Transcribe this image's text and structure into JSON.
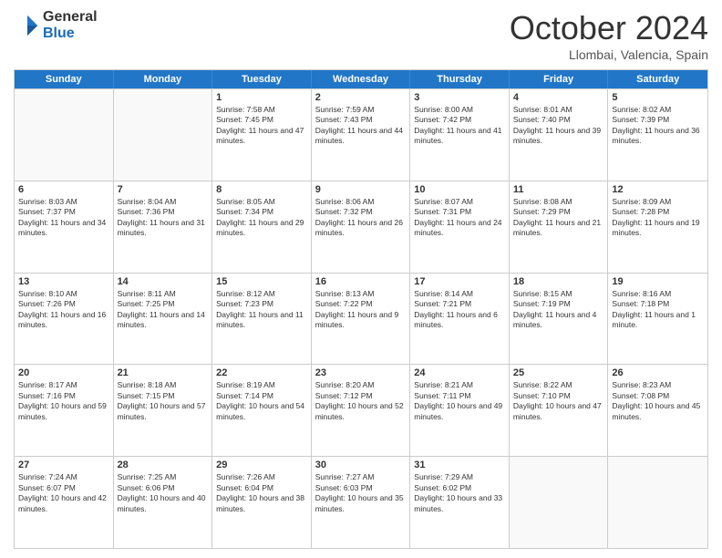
{
  "logo": {
    "general": "General",
    "blue": "Blue"
  },
  "title": "October 2024",
  "subtitle": "Llombai, Valencia, Spain",
  "header_days": [
    "Sunday",
    "Monday",
    "Tuesday",
    "Wednesday",
    "Thursday",
    "Friday",
    "Saturday"
  ],
  "rows": [
    [
      {
        "day": "",
        "sunrise": "",
        "sunset": "",
        "daylight": "",
        "empty": true
      },
      {
        "day": "",
        "sunrise": "",
        "sunset": "",
        "daylight": "",
        "empty": true
      },
      {
        "day": "1",
        "sunrise": "Sunrise: 7:58 AM",
        "sunset": "Sunset: 7:45 PM",
        "daylight": "Daylight: 11 hours and 47 minutes.",
        "empty": false
      },
      {
        "day": "2",
        "sunrise": "Sunrise: 7:59 AM",
        "sunset": "Sunset: 7:43 PM",
        "daylight": "Daylight: 11 hours and 44 minutes.",
        "empty": false
      },
      {
        "day": "3",
        "sunrise": "Sunrise: 8:00 AM",
        "sunset": "Sunset: 7:42 PM",
        "daylight": "Daylight: 11 hours and 41 minutes.",
        "empty": false
      },
      {
        "day": "4",
        "sunrise": "Sunrise: 8:01 AM",
        "sunset": "Sunset: 7:40 PM",
        "daylight": "Daylight: 11 hours and 39 minutes.",
        "empty": false
      },
      {
        "day": "5",
        "sunrise": "Sunrise: 8:02 AM",
        "sunset": "Sunset: 7:39 PM",
        "daylight": "Daylight: 11 hours and 36 minutes.",
        "empty": false
      }
    ],
    [
      {
        "day": "6",
        "sunrise": "Sunrise: 8:03 AM",
        "sunset": "Sunset: 7:37 PM",
        "daylight": "Daylight: 11 hours and 34 minutes.",
        "empty": false
      },
      {
        "day": "7",
        "sunrise": "Sunrise: 8:04 AM",
        "sunset": "Sunset: 7:36 PM",
        "daylight": "Daylight: 11 hours and 31 minutes.",
        "empty": false
      },
      {
        "day": "8",
        "sunrise": "Sunrise: 8:05 AM",
        "sunset": "Sunset: 7:34 PM",
        "daylight": "Daylight: 11 hours and 29 minutes.",
        "empty": false
      },
      {
        "day": "9",
        "sunrise": "Sunrise: 8:06 AM",
        "sunset": "Sunset: 7:32 PM",
        "daylight": "Daylight: 11 hours and 26 minutes.",
        "empty": false
      },
      {
        "day": "10",
        "sunrise": "Sunrise: 8:07 AM",
        "sunset": "Sunset: 7:31 PM",
        "daylight": "Daylight: 11 hours and 24 minutes.",
        "empty": false
      },
      {
        "day": "11",
        "sunrise": "Sunrise: 8:08 AM",
        "sunset": "Sunset: 7:29 PM",
        "daylight": "Daylight: 11 hours and 21 minutes.",
        "empty": false
      },
      {
        "day": "12",
        "sunrise": "Sunrise: 8:09 AM",
        "sunset": "Sunset: 7:28 PM",
        "daylight": "Daylight: 11 hours and 19 minutes.",
        "empty": false
      }
    ],
    [
      {
        "day": "13",
        "sunrise": "Sunrise: 8:10 AM",
        "sunset": "Sunset: 7:26 PM",
        "daylight": "Daylight: 11 hours and 16 minutes.",
        "empty": false
      },
      {
        "day": "14",
        "sunrise": "Sunrise: 8:11 AM",
        "sunset": "Sunset: 7:25 PM",
        "daylight": "Daylight: 11 hours and 14 minutes.",
        "empty": false
      },
      {
        "day": "15",
        "sunrise": "Sunrise: 8:12 AM",
        "sunset": "Sunset: 7:23 PM",
        "daylight": "Daylight: 11 hours and 11 minutes.",
        "empty": false
      },
      {
        "day": "16",
        "sunrise": "Sunrise: 8:13 AM",
        "sunset": "Sunset: 7:22 PM",
        "daylight": "Daylight: 11 hours and 9 minutes.",
        "empty": false
      },
      {
        "day": "17",
        "sunrise": "Sunrise: 8:14 AM",
        "sunset": "Sunset: 7:21 PM",
        "daylight": "Daylight: 11 hours and 6 minutes.",
        "empty": false
      },
      {
        "day": "18",
        "sunrise": "Sunrise: 8:15 AM",
        "sunset": "Sunset: 7:19 PM",
        "daylight": "Daylight: 11 hours and 4 minutes.",
        "empty": false
      },
      {
        "day": "19",
        "sunrise": "Sunrise: 8:16 AM",
        "sunset": "Sunset: 7:18 PM",
        "daylight": "Daylight: 11 hours and 1 minute.",
        "empty": false
      }
    ],
    [
      {
        "day": "20",
        "sunrise": "Sunrise: 8:17 AM",
        "sunset": "Sunset: 7:16 PM",
        "daylight": "Daylight: 10 hours and 59 minutes.",
        "empty": false
      },
      {
        "day": "21",
        "sunrise": "Sunrise: 8:18 AM",
        "sunset": "Sunset: 7:15 PM",
        "daylight": "Daylight: 10 hours and 57 minutes.",
        "empty": false
      },
      {
        "day": "22",
        "sunrise": "Sunrise: 8:19 AM",
        "sunset": "Sunset: 7:14 PM",
        "daylight": "Daylight: 10 hours and 54 minutes.",
        "empty": false
      },
      {
        "day": "23",
        "sunrise": "Sunrise: 8:20 AM",
        "sunset": "Sunset: 7:12 PM",
        "daylight": "Daylight: 10 hours and 52 minutes.",
        "empty": false
      },
      {
        "day": "24",
        "sunrise": "Sunrise: 8:21 AM",
        "sunset": "Sunset: 7:11 PM",
        "daylight": "Daylight: 10 hours and 49 minutes.",
        "empty": false
      },
      {
        "day": "25",
        "sunrise": "Sunrise: 8:22 AM",
        "sunset": "Sunset: 7:10 PM",
        "daylight": "Daylight: 10 hours and 47 minutes.",
        "empty": false
      },
      {
        "day": "26",
        "sunrise": "Sunrise: 8:23 AM",
        "sunset": "Sunset: 7:08 PM",
        "daylight": "Daylight: 10 hours and 45 minutes.",
        "empty": false
      }
    ],
    [
      {
        "day": "27",
        "sunrise": "Sunrise: 7:24 AM",
        "sunset": "Sunset: 6:07 PM",
        "daylight": "Daylight: 10 hours and 42 minutes.",
        "empty": false
      },
      {
        "day": "28",
        "sunrise": "Sunrise: 7:25 AM",
        "sunset": "Sunset: 6:06 PM",
        "daylight": "Daylight: 10 hours and 40 minutes.",
        "empty": false
      },
      {
        "day": "29",
        "sunrise": "Sunrise: 7:26 AM",
        "sunset": "Sunset: 6:04 PM",
        "daylight": "Daylight: 10 hours and 38 minutes.",
        "empty": false
      },
      {
        "day": "30",
        "sunrise": "Sunrise: 7:27 AM",
        "sunset": "Sunset: 6:03 PM",
        "daylight": "Daylight: 10 hours and 35 minutes.",
        "empty": false
      },
      {
        "day": "31",
        "sunrise": "Sunrise: 7:29 AM",
        "sunset": "Sunset: 6:02 PM",
        "daylight": "Daylight: 10 hours and 33 minutes.",
        "empty": false
      },
      {
        "day": "",
        "sunrise": "",
        "sunset": "",
        "daylight": "",
        "empty": true
      },
      {
        "day": "",
        "sunrise": "",
        "sunset": "",
        "daylight": "",
        "empty": true
      }
    ]
  ]
}
